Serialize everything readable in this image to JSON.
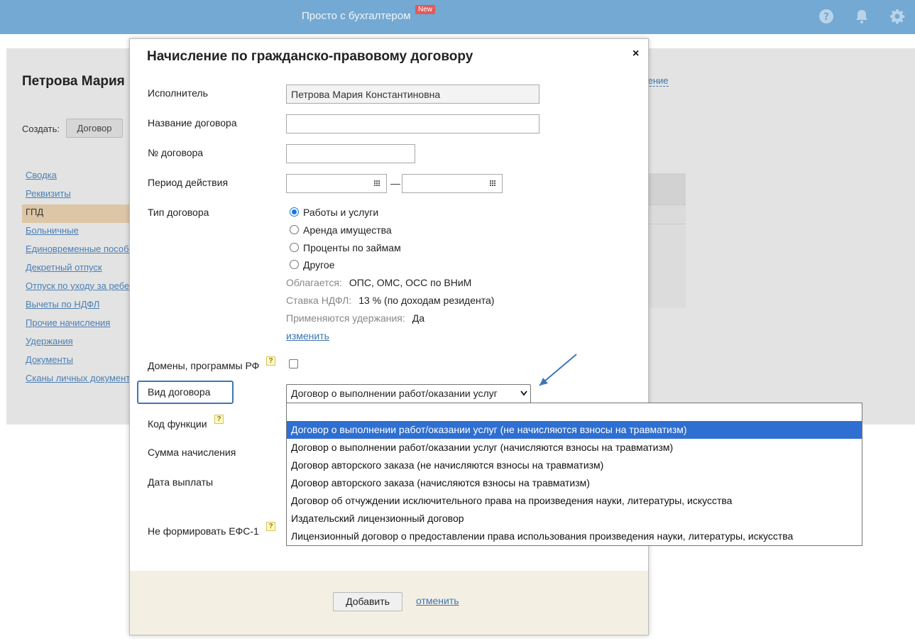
{
  "topbar": {
    "brand": "Просто с бухгалтером",
    "badge": "New",
    "icons": [
      "help-icon",
      "bell-icon",
      "gear-icon"
    ]
  },
  "background": {
    "person_title": "Петрова Мария",
    "create_label": "Создать:",
    "create_button": "Договор",
    "right_link": "ление",
    "nav": [
      "Сводка",
      "Реквизиты",
      "ГПД",
      "Больничные",
      "Единовременные пособи",
      "Декретный отпуск",
      "Отпуск по уходу за ребе",
      "Вычеты по НДФЛ",
      "Прочие начисления",
      "Удержания",
      "Документы",
      "Сканы личных документ"
    ],
    "active_nav": "ГПД"
  },
  "modal": {
    "title": "Начисление по гражданско-правовому договору",
    "close": "×",
    "labels": {
      "executor": "Исполнитель",
      "contract_name": "Название договора",
      "contract_no": "№ договора",
      "period": "Период действия",
      "contract_type": "Тип договора",
      "domains": "Домены, программы РФ",
      "contract_kind": "Вид договора",
      "function_code": "Код функции",
      "amount": "Сумма начисления",
      "pay_date": "Дата выплаты",
      "no_efs": "Не формировать ЕФС-1"
    },
    "values": {
      "executor": "Петрова Мария Константиновна",
      "contract_name": "",
      "contract_no": "",
      "period_from": "",
      "period_to": "",
      "period_dash": "—"
    },
    "contract_types": [
      {
        "label": "Работы и услуги",
        "checked": true
      },
      {
        "label": "Аренда имущества",
        "checked": false
      },
      {
        "label": "Проценты по займам",
        "checked": false
      },
      {
        "label": "Другое",
        "checked": false
      }
    ],
    "info": {
      "taxed_key": "Облагается:",
      "taxed_val": "ОПС, ОМС, ОСС по ВНиМ",
      "ndfl_key": "Ставка НДФЛ:",
      "ndfl_val": "13 % (по доходам резидента)",
      "deductions_key": "Применяются удержания:",
      "deductions_val": "Да",
      "change_link": "изменить"
    },
    "help_glyph": "?",
    "domains_checked": false,
    "selected_kind": "Договор о выполнении работ/оказании услуг",
    "footer": {
      "add_button": "Добавить",
      "cancel_link": "отменить"
    }
  },
  "dropdown": {
    "options": [
      "",
      "Договор о выполнении работ/оказании услуг (не начисляются взносы на травматизм)",
      "Договор о выполнении работ/оказании услуг (начисляются взносы на травматизм)",
      "Договор авторского заказа (не начисляются взносы на травматизм)",
      "Договор авторского заказа (начисляются взносы на травматизм)",
      "Договор об отчуждении исключительного права на произведения науки, литературы, искусства",
      "Издательский лицензионный договор",
      "Лицензионный договор о предоставлении права использования произведения науки, литературы, искусства"
    ],
    "selected_index": 1
  },
  "colors": {
    "topbar": "#73a9d2",
    "accent": "#3d78b5",
    "selection": "#2f6fd1",
    "footer": "#f4efe3"
  }
}
